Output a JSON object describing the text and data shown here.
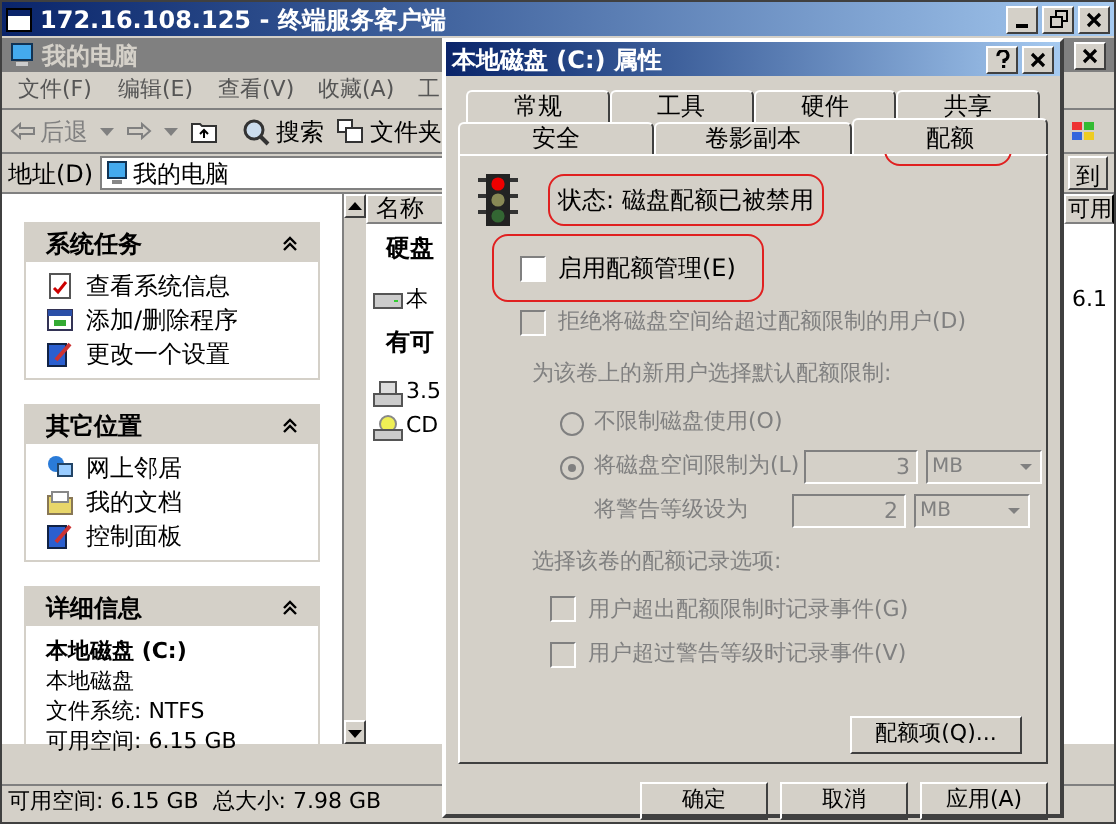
{
  "terminal_window": {
    "title": "172.16.108.125 - 终端服务客户端"
  },
  "explorer": {
    "title": "我的电脑",
    "menu": [
      "文件(F)",
      "编辑(E)",
      "查看(V)",
      "收藏(A)",
      "工"
    ],
    "toolbar": {
      "back": "后退",
      "search": "搜索",
      "folders": "文件夹"
    },
    "address": {
      "label": "地址(D)",
      "value": "我的电脑",
      "go": "到"
    },
    "panels": [
      {
        "title": "系统任务",
        "items": [
          {
            "label": "查看系统信息",
            "kind": "info"
          },
          {
            "label": "添加/删除程序",
            "kind": "programs"
          },
          {
            "label": "更改一个设置",
            "kind": "settings"
          }
        ]
      },
      {
        "title": "其它位置",
        "items": [
          {
            "label": "网上邻居",
            "kind": "network"
          },
          {
            "label": "我的文档",
            "kind": "documents"
          },
          {
            "label": "控制面板",
            "kind": "settings"
          }
        ]
      }
    ],
    "details": {
      "title": "详细信息",
      "name": "本地磁盘 (C:)",
      "type": "本地磁盘",
      "lines": [
        "文件系统: NTFS",
        "可用空间: 6.15 GB"
      ]
    },
    "list": {
      "columns": [
        "名称",
        "可用"
      ],
      "groups": [
        {
          "title": "硬盘",
          "items": [
            {
              "name": "本",
              "free": "6.1",
              "kind": "disk"
            }
          ]
        },
        {
          "title": "有可",
          "items": [
            {
              "name": "3.5",
              "kind": "floppy"
            },
            {
              "name": "CD",
              "kind": "cd"
            }
          ]
        }
      ]
    },
    "status_bar": "可用空间: 6.15 GB  总大小: 7.98 GB"
  },
  "dialog": {
    "title": "本地磁盘 (C:) 属性",
    "tab_rows": [
      [
        {
          "label": "常规",
          "selected": false
        },
        {
          "label": "工具",
          "selected": false
        },
        {
          "label": "硬件",
          "selected": false
        },
        {
          "label": "共享",
          "selected": false
        }
      ],
      [
        {
          "label": "安全",
          "selected": false
        },
        {
          "label": "卷影副本",
          "selected": false
        },
        {
          "label": "配额",
          "selected": true
        }
      ]
    ],
    "status": "状态: 磁盘配额已被禁用",
    "enable": {
      "label": "启用配额管理(E)",
      "checked": false,
      "disabled": false
    },
    "deny": {
      "label": "拒绝将磁盘空间给超过配额限制的用户(D)",
      "checked": false,
      "disabled": true
    },
    "default_label": "为该卷上的新用户选择默认配额限制:",
    "radios": [
      {
        "label": "不限制磁盘使用(O)",
        "selected": false
      },
      {
        "label": "将磁盘空间限制为(L)",
        "selected": true,
        "value": "3",
        "unit": "MB"
      }
    ],
    "warning": {
      "label": "将警告等级设为",
      "value": "2",
      "unit": "MB"
    },
    "log_label": "选择该卷的配额记录选项:",
    "log_options": [
      {
        "label": "用户超出配额限制时记录事件(G)",
        "checked": false
      },
      {
        "label": "用户超过警告等级时记录事件(V)",
        "checked": false
      }
    ],
    "entries_button": "配额项(Q)...",
    "buttons": [
      "确定",
      "取消",
      "应用(A)"
    ]
  }
}
